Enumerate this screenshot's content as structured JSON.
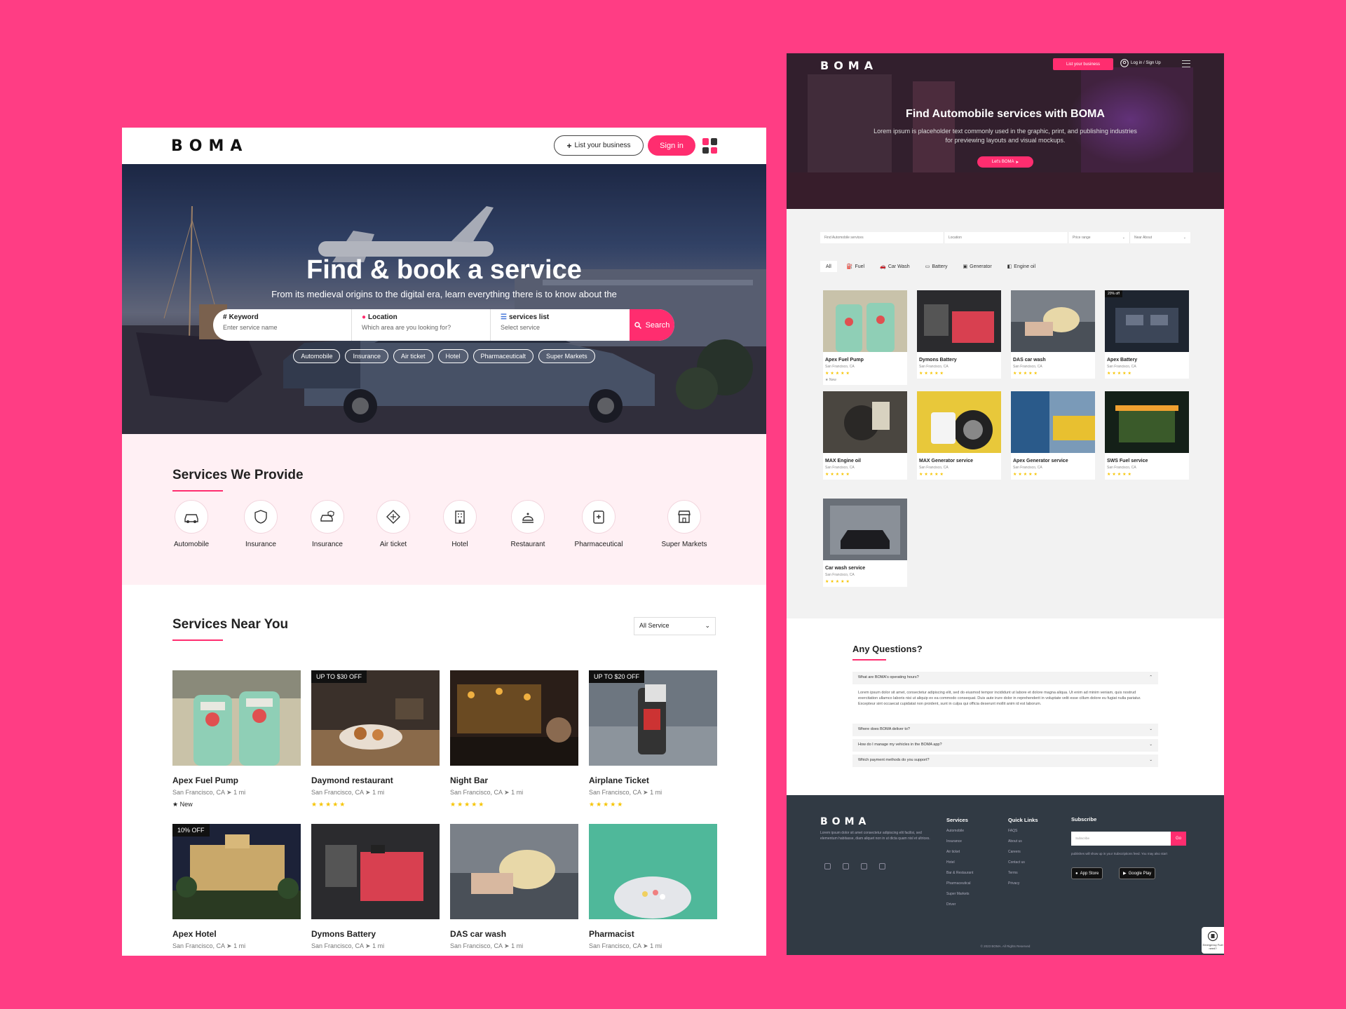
{
  "left": {
    "logo": "BOMA",
    "nav": {
      "list_label": "List your business",
      "signin_label": "Sign in"
    },
    "hero": {
      "title": "Find & book a service",
      "subtitle": "From its medieval origins to the digital era, learn everything there is to know about the",
      "fields": [
        {
          "label": "Keyword",
          "placeholder": "Enter service name"
        },
        {
          "label": "Location",
          "placeholder": "Which area are you looking for?"
        },
        {
          "label": "services list",
          "placeholder": "Select service"
        }
      ],
      "search_label": "Search",
      "tags": [
        "Automobile",
        "Insurance",
        "Air ticket",
        "Hotel",
        "Pharmaceuticalt",
        "Super Markets"
      ]
    },
    "services": {
      "title": "Services We Provide",
      "items": [
        "Automobile",
        "Insurance",
        "Insurance",
        "Air ticket",
        "Hotel",
        "Restaurant",
        "Pharmaceutical",
        "Super Markets"
      ]
    },
    "near": {
      "title": "Services Near You",
      "select_value": "All Service",
      "cards": [
        {
          "name": "Apex Fuel Pump",
          "loc": "San Francisco, CA",
          "dist": "1 mi",
          "badge": "",
          "extra": "New"
        },
        {
          "name": "Daymond restaurant",
          "loc": "San Francisco, CA",
          "dist": "1 mi",
          "badge": "UP TO $30 OFF",
          "extra": "★★★★★"
        },
        {
          "name": "Night Bar",
          "loc": "San Francisco, CA",
          "dist": "1 mi",
          "badge": "",
          "extra": "★★★★★"
        },
        {
          "name": "Airplane Ticket",
          "loc": "San Francisco, CA",
          "dist": "1 mi",
          "badge": "UP TO $20 OFF",
          "extra": "★★★★★"
        },
        {
          "name": "Apex Hotel",
          "loc": "San Francisco, CA",
          "dist": "1 mi",
          "badge": "10% OFF",
          "extra": ""
        },
        {
          "name": "Dymons Battery",
          "loc": "San Francisco, CA",
          "dist": "1 mi",
          "badge": "",
          "extra": ""
        },
        {
          "name": "DAS car wash",
          "loc": "San Francisco, CA",
          "dist": "1 mi",
          "badge": "",
          "extra": ""
        },
        {
          "name": "Pharmacist",
          "loc": "San Francisco, CA",
          "dist": "1 mi",
          "badge": "",
          "extra": ""
        }
      ]
    }
  },
  "right": {
    "logo": "BOMA",
    "nav": {
      "list_label": "List your business",
      "login_label": "Log in / Sign Up"
    },
    "hero": {
      "title": "Find Automobile services with BOMA",
      "subtitle": "Lorem ipsum is placeholder text commonly used in the graphic, print, and publishing industries for previewing layouts and visual mockups.",
      "cta_label": "Let's BOMA"
    },
    "filters": [
      "Find Automobile services",
      "Location",
      "Price range",
      "Near About"
    ],
    "tabs": [
      "All",
      "Fuel",
      "Car Wash",
      "Battery",
      "Generator",
      "Engine oil"
    ],
    "cards": [
      {
        "name": "Apex Fuel Pump",
        "loc": "San Francisco, CA",
        "badge": "",
        "extra": "New",
        "rating": "★★★★★"
      },
      {
        "name": "Dymons Battery",
        "loc": "San Francisco, CA",
        "badge": "",
        "extra": "",
        "rating": "★★★★★"
      },
      {
        "name": "DAS car wash",
        "loc": "San Francisco, CA",
        "badge": "",
        "extra": "",
        "rating": "★★★★★"
      },
      {
        "name": "Apex Battery",
        "loc": "San Francisco, CA",
        "badge": "20% off",
        "extra": "",
        "rating": "★★★★★"
      },
      {
        "name": "MAX Engine oil",
        "loc": "San Francisco, CA",
        "badge": "",
        "extra": "",
        "rating": "★★★★★"
      },
      {
        "name": "MAX Generator service",
        "loc": "San Francisco, CA",
        "badge": "",
        "extra": "",
        "rating": "★★★★★"
      },
      {
        "name": "Apex Generator service",
        "loc": "San Francisco, CA",
        "badge": "",
        "extra": "",
        "rating": "★★★★★"
      },
      {
        "name": "SWS Fuel service",
        "loc": "San Francisco, CA",
        "badge": "",
        "extra": "",
        "rating": "★★★★★"
      },
      {
        "name": "Car wash service",
        "loc": "San Francisco, CA",
        "badge": "",
        "extra": "",
        "rating": "★★★★★"
      }
    ],
    "faq": {
      "title": "Any Questions?",
      "questions": [
        "What are BOMA's operating hours?",
        "Where does BOMA deliver to?",
        "How do I manage my vehicles in the BOMA app?",
        "Which payment methods do you support?"
      ],
      "answer": "Lorem ipsum dolor sit amet, consectetur adipiscing elit, sed do eiusmod tempor incididunt ut labore et dolore magna aliqua. Ut enim ad minim veniam, quis nostrud exercitation ullamco laboris nisi ut aliquip ex ea commodo consequat. Duis aute irure dolor in reprehenderit in voluptate velit esse cillum dolore eu fugiat nulla pariatur. Excepteur sint occaecat cupidatat non proident, sunt in culpa qui officia deserunt mollit anim id est laborum."
    },
    "footer": {
      "about": "Lorem ipsum dolor sit amet consectetur adipiscing elit facilisi, sed elementum habitasse, diam aliquet non in ut dicta quam nisl et ultrices.",
      "services_title": "Services",
      "services": [
        "Automobile",
        "Insurance",
        "Air ticket",
        "Hotel",
        "Bar & Restaurant",
        "Pharmaceutical",
        "Super Markets",
        "Driver"
      ],
      "quick_title": "Quick Links",
      "quick": [
        "FAQS",
        "About us",
        "Careers",
        "Contact us",
        "Terms",
        "Privacy"
      ],
      "subscribe_title": "Subscribe",
      "subscribe_placeholder": "Subscribe",
      "subscribe_go": "Go",
      "subscribe_text": "publishes will show up in your Subscriptions feed. You may also start",
      "app_store": "App Store",
      "google_play": "Google Play",
      "copyright": "© 2023 BOMA. All Rights Reserved"
    },
    "chat_label": "Emergency Fuel need?"
  },
  "colors": {
    "accent": "#ff2d6f",
    "background": "#ff3d84",
    "footer": "#313a44",
    "soft_pink": "#fff0f4"
  }
}
